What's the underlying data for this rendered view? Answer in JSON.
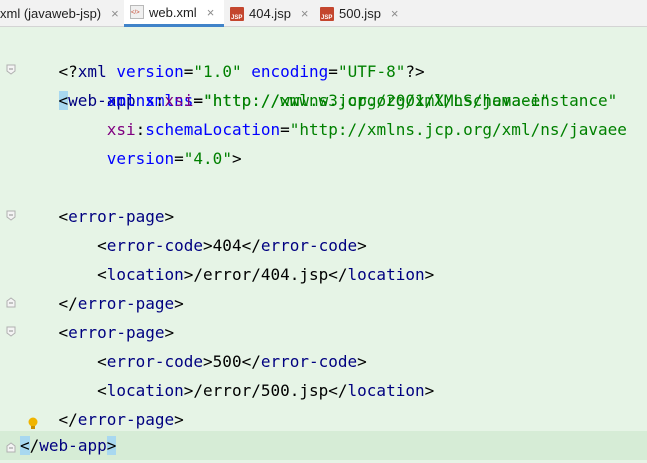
{
  "tabs": [
    {
      "label": "xml (javaweb-jsp)",
      "icon": "xml-file-icon",
      "active": false
    },
    {
      "label": "web.xml",
      "icon": "xml-file-icon",
      "active": true
    },
    {
      "label": "404.jsp",
      "icon": "jsp-file-icon",
      "active": false
    },
    {
      "label": "500.jsp",
      "icon": "jsp-file-icon",
      "active": false
    }
  ],
  "tab_close_glyph": "×",
  "jsp_badge": "JSP",
  "code": {
    "l1": {
      "open": "<?",
      "name": "xml",
      "a1": "version",
      "v1": "\"1.0\"",
      "a2": "encoding",
      "v2": "\"UTF-8\"",
      "close": "?>"
    },
    "l2": {
      "lt": "<",
      "tag": "web-app",
      "attr": "xmlns",
      "eq": "=",
      "val": "\"http://xmlns.jcp.org/xml/ns/javaee\""
    },
    "l3": {
      "ns": "xmlns",
      "colon": ":",
      "attr": "xsi",
      "eq": "=",
      "val": "\"http://www.w3.org/2001/XMLSchema-instance\""
    },
    "l4": {
      "ns": "xsi",
      "colon": ":",
      "attr": "schemaLocation",
      "eq": "=",
      "val": "\"http://xmlns.jcp.org/xml/ns/javaee"
    },
    "l5": {
      "attr": "version",
      "eq": "=",
      "val": "\"4.0\"",
      "close": ">"
    },
    "ep_open": "error-page",
    "ec": "error-code",
    "loc": "location",
    "code404": "404",
    "path404": "/error/404.jsp",
    "code500": "500",
    "path500": "/error/500.jsp",
    "root_close": "web-app"
  },
  "colors": {
    "editor_bg": "#e6f4e6",
    "tag": "#000080",
    "attr": "#0000ff",
    "value": "#008000",
    "namespace": "#800080"
  }
}
